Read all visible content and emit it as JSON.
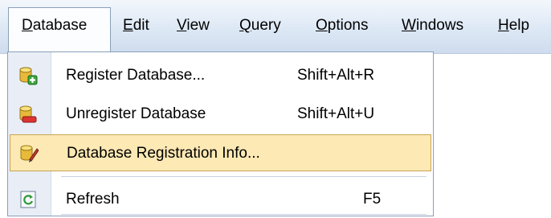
{
  "menubar": {
    "items": [
      {
        "label": "Database",
        "hotkey_index": 0
      },
      {
        "label": "Edit",
        "hotkey_index": 0
      },
      {
        "label": "View",
        "hotkey_index": 0
      },
      {
        "label": "Query",
        "hotkey_index": 0
      },
      {
        "label": "Options",
        "hotkey_index": 0
      },
      {
        "label": "Windows",
        "hotkey_index": 0
      },
      {
        "label": "Help",
        "hotkey_index": 0
      }
    ]
  },
  "dropdown": {
    "items": [
      {
        "label": "Register Database...",
        "shortcut": "Shift+Alt+R",
        "icon": "database-add-icon"
      },
      {
        "label": "Unregister Database",
        "shortcut": "Shift+Alt+U",
        "icon": "database-remove-icon"
      },
      {
        "label": "Database Registration Info...",
        "shortcut": "",
        "icon": "database-edit-icon"
      },
      {
        "label": "Refresh",
        "shortcut": "F5",
        "icon": "refresh-icon"
      }
    ]
  },
  "colors": {
    "highlight": "#fde9b4",
    "highlight_border": "#c7a454",
    "menubar_bg": "#dde8f5"
  }
}
